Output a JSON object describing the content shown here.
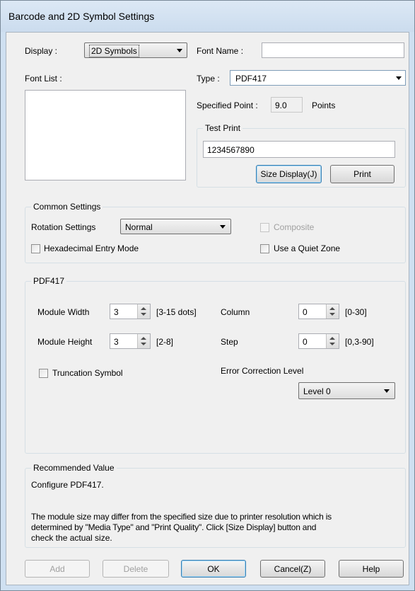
{
  "window": {
    "title": "Barcode and 2D Symbol Settings"
  },
  "display": {
    "label": "Display :",
    "value": "2D Symbols"
  },
  "font_name": {
    "label": "Font Name :",
    "value": ""
  },
  "font_list": {
    "label": "Font List :"
  },
  "type": {
    "label": "Type :",
    "value": "PDF417"
  },
  "specified_point": {
    "label": "Specified Point :",
    "value": "9.0",
    "unit": "Points"
  },
  "test_print": {
    "group_label": "Test Print",
    "value": "1234567890",
    "size_display_label": "Size Display(J)",
    "print_label": "Print"
  },
  "common_settings": {
    "group_label": "Common Settings",
    "rotation_label": "Rotation Settings",
    "rotation_value": "Normal",
    "composite_label": "Composite",
    "hex_entry_label": "Hexadecimal Entry Mode",
    "quiet_zone_label": "Use a Quiet Zone"
  },
  "pdf417": {
    "group_label": "PDF417",
    "module_width": {
      "label": "Module Width",
      "value": "3",
      "range": "[3-15 dots]"
    },
    "module_height": {
      "label": "Module Height",
      "value": "3",
      "range": "[2-8]"
    },
    "column": {
      "label": "Column",
      "value": "0",
      "range": "[0-30]"
    },
    "step": {
      "label": "Step",
      "value": "0",
      "range": "[0,3-90]"
    },
    "truncation_label": "Truncation Symbol",
    "ecl_label": "Error Correction Level",
    "ecl_value": "Level 0"
  },
  "recommended": {
    "group_label": "Recommended Value",
    "line1": "Configure PDF417.",
    "line2": "The module size may differ from the specified size due to printer resolution which is",
    "line3": "determined by \"Media Type\" and \"Print Quality\". Click [Size Display] button and",
    "line4": "check the actual size."
  },
  "buttons": {
    "add": "Add",
    "delete": "Delete",
    "ok": "OK",
    "cancel": "Cancel(Z)",
    "help": "Help"
  }
}
